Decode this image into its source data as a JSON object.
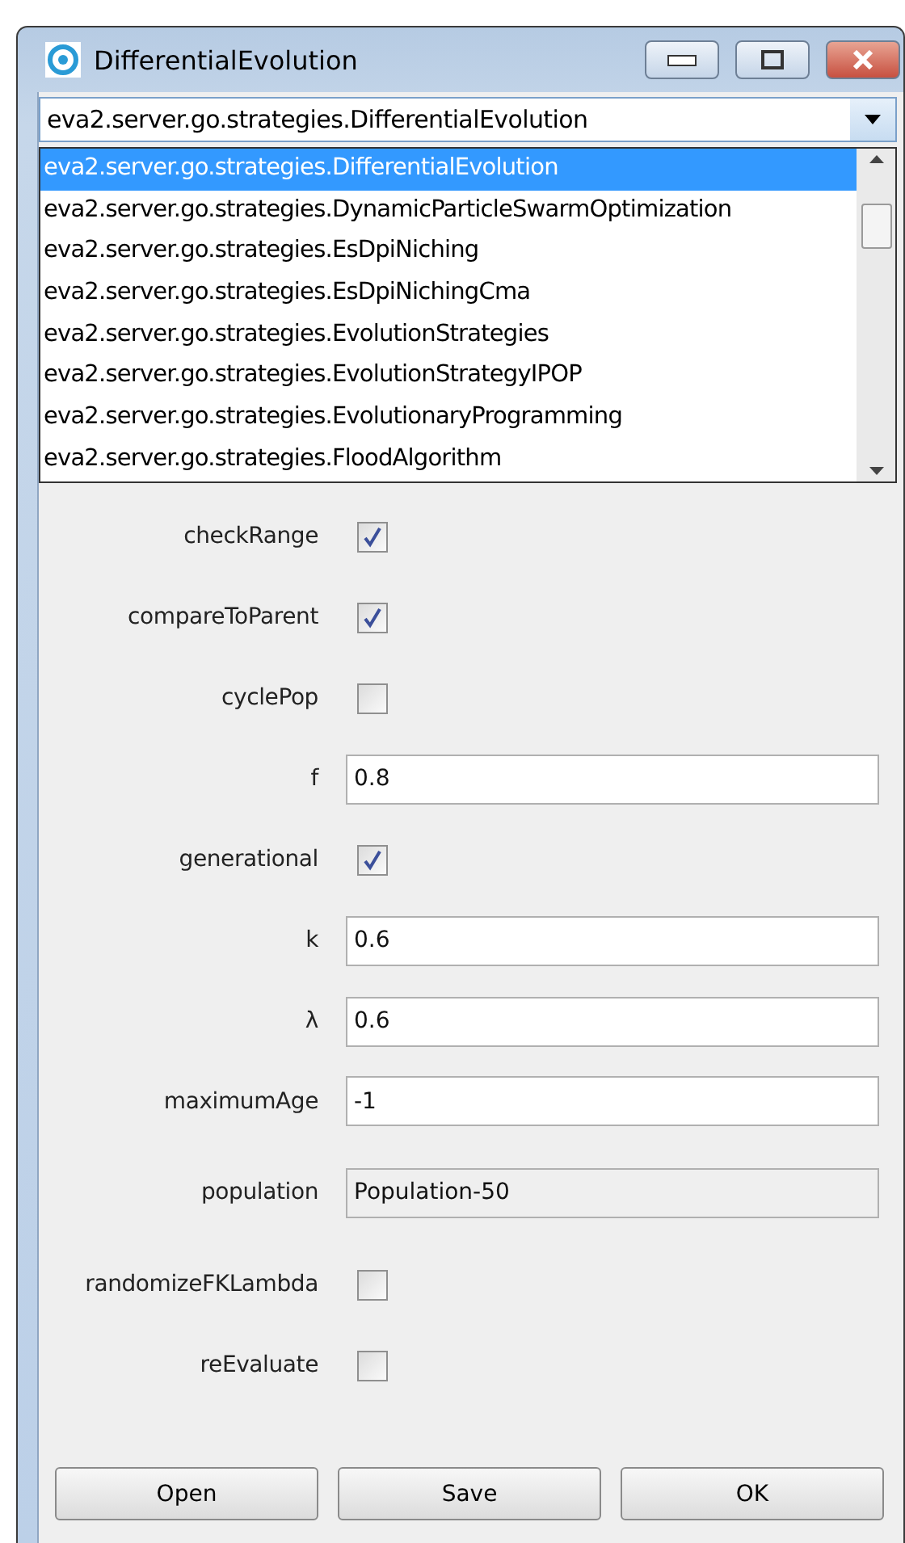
{
  "window": {
    "title": "DifferentialEvolution"
  },
  "combo": {
    "value": "eva2.server.go.strategies.DifferentialEvolution",
    "expanded": true
  },
  "options": [
    {
      "label": "eva2.server.go.strategies.DifferentialEvolution",
      "selected": true
    },
    {
      "label": "eva2.server.go.strategies.DynamicParticleSwarmOptimization",
      "selected": false
    },
    {
      "label": "eva2.server.go.strategies.EsDpiNiching",
      "selected": false
    },
    {
      "label": "eva2.server.go.strategies.EsDpiNichingCma",
      "selected": false
    },
    {
      "label": "eva2.server.go.strategies.EvolutionStrategies",
      "selected": false
    },
    {
      "label": "eva2.server.go.strategies.EvolutionStrategyIPOP",
      "selected": false
    },
    {
      "label": "eva2.server.go.strategies.EvolutionaryProgramming",
      "selected": false
    },
    {
      "label": "eva2.server.go.strategies.FloodAlgorithm",
      "selected": false
    }
  ],
  "properties": [
    {
      "kind": "checkbox",
      "label": "checkRange",
      "checked": true
    },
    {
      "kind": "checkbox",
      "label": "compareToParent",
      "checked": true
    },
    {
      "kind": "checkbox",
      "label": "cyclePop",
      "checked": false
    },
    {
      "kind": "text",
      "label": "f",
      "value": "0.8"
    },
    {
      "kind": "checkbox",
      "label": "generational",
      "checked": true
    },
    {
      "kind": "text",
      "label": "k",
      "value": "0.6"
    },
    {
      "kind": "text",
      "label": "λ",
      "value": "0.6"
    },
    {
      "kind": "text",
      "label": "maximumAge",
      "value": "-1"
    },
    {
      "kind": "object",
      "label": "population",
      "value": "Population-50"
    },
    {
      "kind": "checkbox",
      "label": "randomizeFKLambda",
      "checked": false
    },
    {
      "kind": "checkbox",
      "label": "reEvaluate",
      "checked": false
    }
  ],
  "buttons": [
    "Open",
    "Save",
    "OK"
  ]
}
